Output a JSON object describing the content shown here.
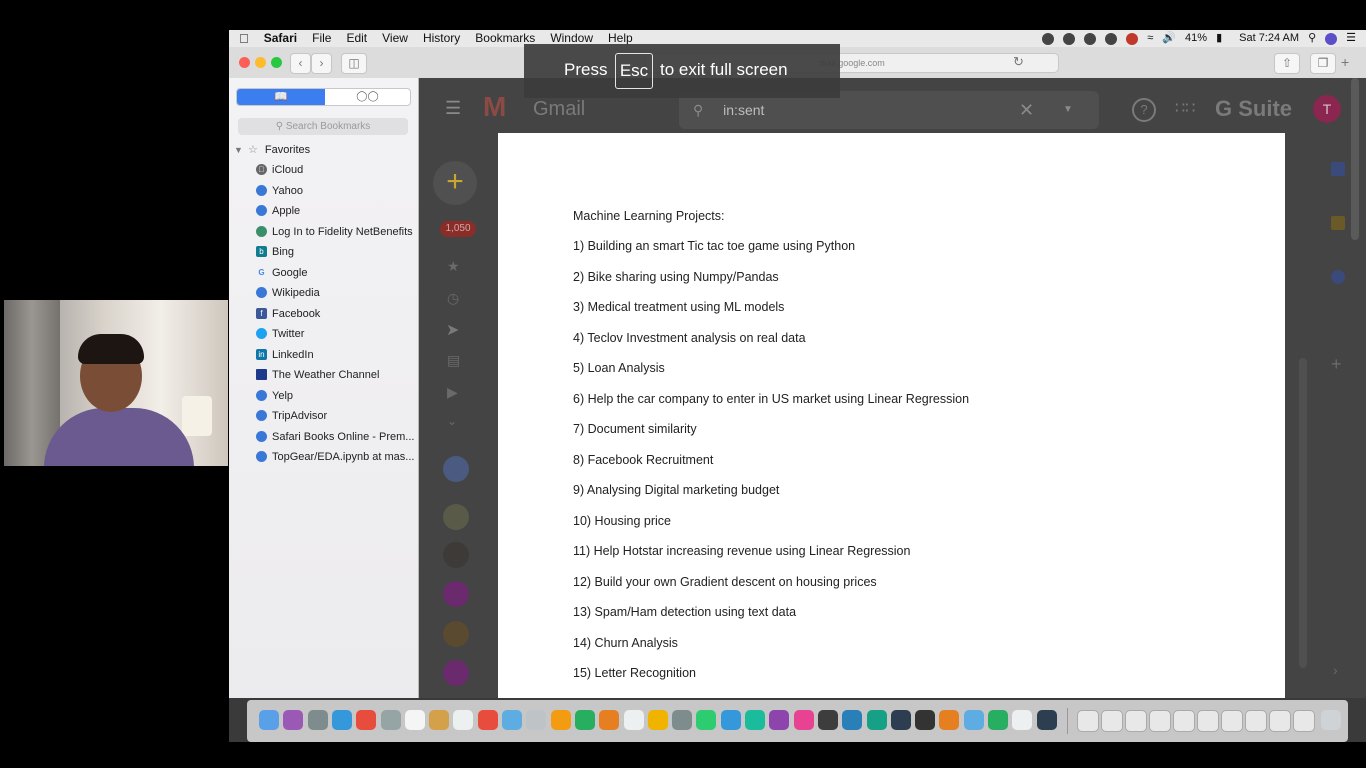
{
  "menubar": {
    "app": "Safari",
    "items": [
      "File",
      "Edit",
      "View",
      "History",
      "Bookmarks",
      "Window",
      "Help"
    ],
    "battery": "41%",
    "clock": "Sat 7:24 AM"
  },
  "browser": {
    "url": "mail.google.com"
  },
  "fullscreen_notice": {
    "press": "Press",
    "key": "Esc",
    "rest": "to exit full screen"
  },
  "sidebar": {
    "search_placeholder": "Search Bookmarks",
    "favorites_label": "Favorites",
    "bookmarks": [
      {
        "label": "iCloud",
        "icon": "apple-icon",
        "color": "#666666"
      },
      {
        "label": "Yahoo",
        "icon": "globe-icon",
        "color": "#3a78d8"
      },
      {
        "label": "Apple",
        "icon": "globe-icon",
        "color": "#3a78d8"
      },
      {
        "label": "Log In to Fidelity NetBenefits",
        "icon": "fidelity-icon",
        "color": "#3a8f6a"
      },
      {
        "label": "Bing",
        "icon": "bing-icon",
        "color": "#0f7c90"
      },
      {
        "label": "Google",
        "icon": "google-icon",
        "color": "#4285f4"
      },
      {
        "label": "Wikipedia",
        "icon": "globe-icon",
        "color": "#3a78d8"
      },
      {
        "label": "Facebook",
        "icon": "facebook-icon",
        "color": "#3b5998"
      },
      {
        "label": "Twitter",
        "icon": "twitter-icon",
        "color": "#1da1f2"
      },
      {
        "label": "LinkedIn",
        "icon": "linkedin-icon",
        "color": "#0e76a8"
      },
      {
        "label": "The Weather Channel",
        "icon": "weather-icon",
        "color": "#1d3a8a"
      },
      {
        "label": "Yelp",
        "icon": "globe-icon",
        "color": "#3a78d8"
      },
      {
        "label": "TripAdvisor",
        "icon": "globe-icon",
        "color": "#3a78d8"
      },
      {
        "label": "Safari Books Online - Prem...",
        "icon": "globe-icon",
        "color": "#3a78d8"
      },
      {
        "label": "TopGear/EDA.ipynb at mas...",
        "icon": "globe-icon",
        "color": "#3a78d8"
      }
    ]
  },
  "gmail": {
    "brand": "Gmail",
    "search_value": "in:sent",
    "badge": "1,050",
    "suite": "G Suite",
    "avatar_letter": "T"
  },
  "document": {
    "title": "Machine Learning Projects:",
    "projects": [
      "1) Building an smart Tic tac toe game using Python",
      "2) Bike sharing using Numpy/Pandas",
      "3) Medical treatment using ML models",
      "4) Teclov Investment analysis on real data",
      "5) Loan Analysis",
      "6) Help the car company to enter in US market using Linear Regression",
      "7) Document similarity",
      "8) Facebook Recruitment",
      "9) Analysing Digital marketing budget",
      "10) Housing price",
      "11) Help Hotstar increasing revenue using Linear Regression",
      "12) Build your own Gradient descent on housing prices",
      "13) Spam/Ham detection using text data",
      "14) Churn Analysis",
      "15) Letter Recognition"
    ]
  },
  "dock": {
    "icon_colors": [
      "#5aa0e8",
      "#9b59b6",
      "#7f8c8d",
      "#3498db",
      "#e74c3c",
      "#95a5a6",
      "#f5f5f5",
      "#d4a04a",
      "#ecf0f1",
      "#e74c3c",
      "#5dade2",
      "#bdc3c7",
      "#f39c12",
      "#27ae60",
      "#e67e22",
      "#ecf0f1",
      "#f0b400",
      "#7f8c8d",
      "#2ecc71",
      "#3498db",
      "#1abc9c",
      "#8e44ad",
      "#e84393",
      "#3d3d3d",
      "#2980b9",
      "#16a085",
      "#2c3e50",
      "#333333",
      "#e67e22",
      "#5dade2",
      "#27ae60",
      "#ecf0f1",
      "#2c3e50"
    ]
  }
}
